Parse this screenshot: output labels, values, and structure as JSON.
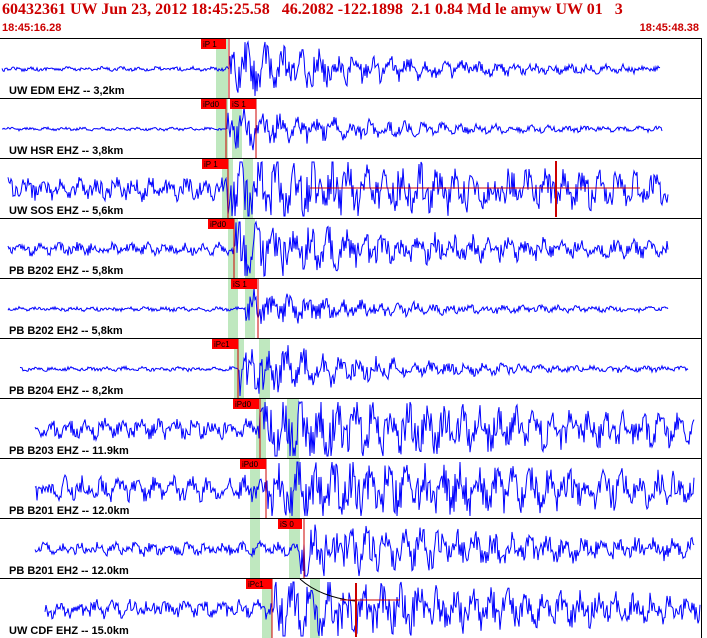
{
  "header": {
    "title": "60432361 UW Jun 23, 2012 18:45:25.58   46.2082 -122.1898  2.1 0.84 Md le amyw UW 01   3",
    "time_start": "18:45:16.28",
    "time_end": "18:45:48.38"
  },
  "colors": {
    "header_text": "#cc0000",
    "trace": "#0000ff",
    "pick_fill": "#ff0000",
    "window_shade": "#bfe8bf",
    "line": "#cc0000"
  },
  "traces": [
    {
      "label": "UW EDM EHZ -- 3,2km",
      "picks": [
        {
          "text": "iP 1"
        }
      ]
    },
    {
      "label": "UW HSR EHZ -- 3,8km",
      "picks": [
        {
          "text": "iPd0"
        },
        {
          "text": "iS 1"
        }
      ]
    },
    {
      "label": "UW SOS EHZ -- 5,6km",
      "picks": [
        {
          "text": "iP 1"
        }
      ]
    },
    {
      "label": "PB B202 EHZ -- 5,8km",
      "picks": [
        {
          "text": "iPd0"
        }
      ]
    },
    {
      "label": "PB B202 EH2 -- 5,8km",
      "picks": [
        {
          "text": "iS 1"
        }
      ]
    },
    {
      "label": "PB B204 EHZ -- 8,2km",
      "picks": [
        {
          "text": "iPc1"
        }
      ]
    },
    {
      "label": "PB B203 EHZ -- 11.9km",
      "picks": [
        {
          "text": "iPd0"
        }
      ]
    },
    {
      "label": "PB B201 EHZ -- 12.0km",
      "picks": [
        {
          "text": "iPd0"
        }
      ]
    },
    {
      "label": "PB B201 EH2 -- 12.0km",
      "picks": [
        {
          "text": "iS 0"
        }
      ]
    },
    {
      "label": "UW CDF EHZ -- 15.0km",
      "picks": [
        {
          "text": "iPc1"
        }
      ]
    }
  ]
}
